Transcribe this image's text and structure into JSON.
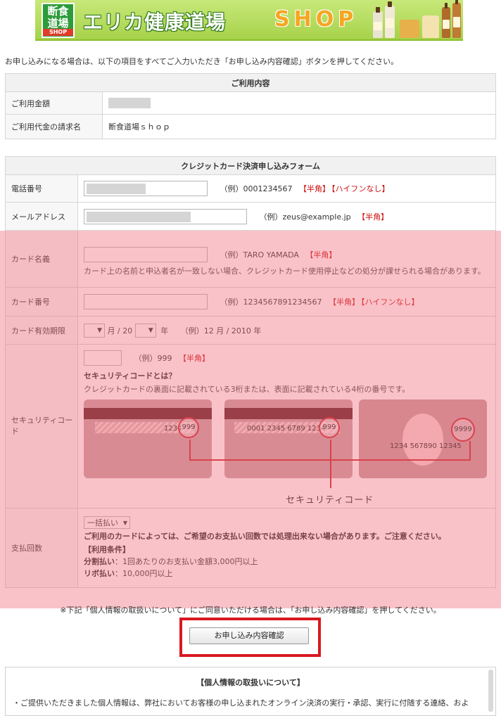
{
  "banner": {
    "logo_lines": [
      "断食",
      "道場",
      "SHOP"
    ],
    "title": "エリカ健康道場",
    "shop_word": "SHOP"
  },
  "intro_text": "お申し込みになる場合は、以下の項目をすべてご入力いただき「お申し込み内容確認」ボタンを押してください。",
  "usage_table": {
    "caption": "ご利用内容",
    "rows": [
      {
        "label": "ご利用金額",
        "value": ""
      },
      {
        "label": "ご利用代金の請求名",
        "value": "断食道場ｓｈｏｐ"
      }
    ]
  },
  "card_form": {
    "caption": "クレジットカード決済申し込みフォーム",
    "phone": {
      "label": "電話番号",
      "example": "（例）0001234567",
      "tags": [
        "【半角】",
        "【ハイフンなし】"
      ]
    },
    "email": {
      "label": "メールアドレス",
      "example": "（例）zeus@example.jp",
      "tags": [
        "【半角】"
      ]
    },
    "card_name": {
      "label": "カード名義",
      "example": "（例）TARO YAMADA",
      "tags": [
        "【半角】"
      ],
      "note": "カード上の名前と申込者名が一致しない場合、クレジットカード使用停止などの処分が課せられる場合があります。"
    },
    "card_number": {
      "label": "カード番号",
      "example": "（例）1234567891234567",
      "tags": [
        "【半角】",
        "【ハイフンなし】"
      ]
    },
    "expiry": {
      "label": "カード有効期限",
      "month_suffix": "月 / 20",
      "year_suffix": "年",
      "example": "（例）12 月 / 2010 年"
    },
    "security": {
      "label": "セキュリティコード",
      "example": "（例）999",
      "tags": [
        "【半角】"
      ],
      "heading": "セキュリティコードとは？",
      "description": "クレジットカードの裏面に記載されている3桁または、表面に記載されている4桁の番号です。",
      "card1_number": "1234",
      "card1_code": "999",
      "card2_number": "0001 2345 6789 1234",
      "card2_code": "999",
      "card3_number": "1234 567890 12345",
      "card3_code": "9999",
      "illustration_label": "セキュリティコード"
    },
    "payment": {
      "label": "支払回数",
      "selected": "一括払い",
      "warning": "ご利用のカードによっては、ご希望のお支払い回数では処理出来ない場合があります。ご注意ください。",
      "conditions_title": "【利用条件】",
      "installment_label": "分割払い",
      "installment_text": "：1回あたりのお支払い金額3,000円以上",
      "revolving_label": "リボ払い",
      "revolving_text": "：10,000円以上"
    }
  },
  "footer_note": "※下記「個人情報の取扱いについて」にご同意いただける場合は、「お申し込み内容確認」を押してください。",
  "confirm_button": "お申し込み内容確認",
  "privacy": {
    "title": "【個人情報の取扱いについて】",
    "body": "・ご提供いただきました個人情報は、弊社においてお客様の申し込まれたオンライン決済の実行・承認、実行に付随する連絡、およ"
  },
  "colors": {
    "required_red": "#cc1111",
    "highlight_pink": "#f06e7d",
    "frame_red": "#d71920",
    "banner_green": "#a6d24a"
  }
}
